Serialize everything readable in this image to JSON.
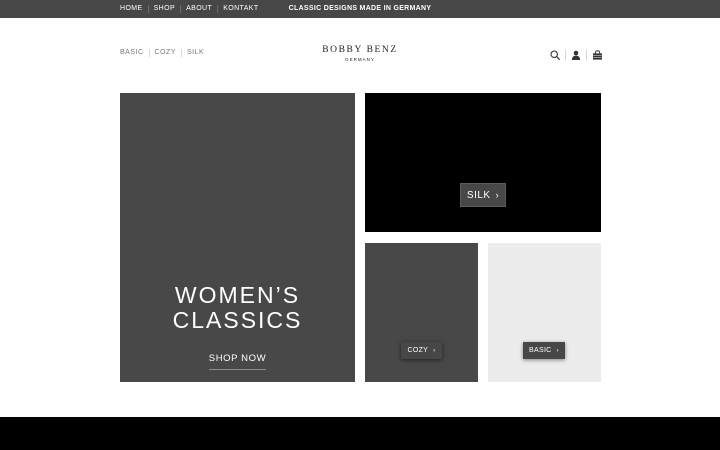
{
  "topbar": {
    "nav": [
      "HOME",
      "SHOP",
      "ABOUT",
      "KONTAKT"
    ],
    "tagline": "CLASSIC DESIGNS MADE IN GERMANY"
  },
  "header": {
    "categories": [
      "BASIC",
      "COZY",
      "SILK"
    ],
    "logo": {
      "name": "BOBBY BENZ",
      "sub": "GERMANY"
    },
    "icons": [
      "search-icon",
      "account-icon",
      "cart-icon"
    ]
  },
  "tiles": {
    "women": {
      "title_line1": "WOMEN’S",
      "title_line2": "CLASSICS",
      "cta": "SHOP NOW"
    },
    "silk": {
      "label": "SILK",
      "chevron": "›"
    },
    "cozy": {
      "label": "COZY",
      "chevron": "›"
    },
    "basic": {
      "label": "BASIC",
      "chevron": "›"
    }
  },
  "colors": {
    "topbar": "#474747",
    "tile_dark": "#484848",
    "tile_black": "#000000",
    "tile_light": "#ececec",
    "footer": "#000000"
  }
}
